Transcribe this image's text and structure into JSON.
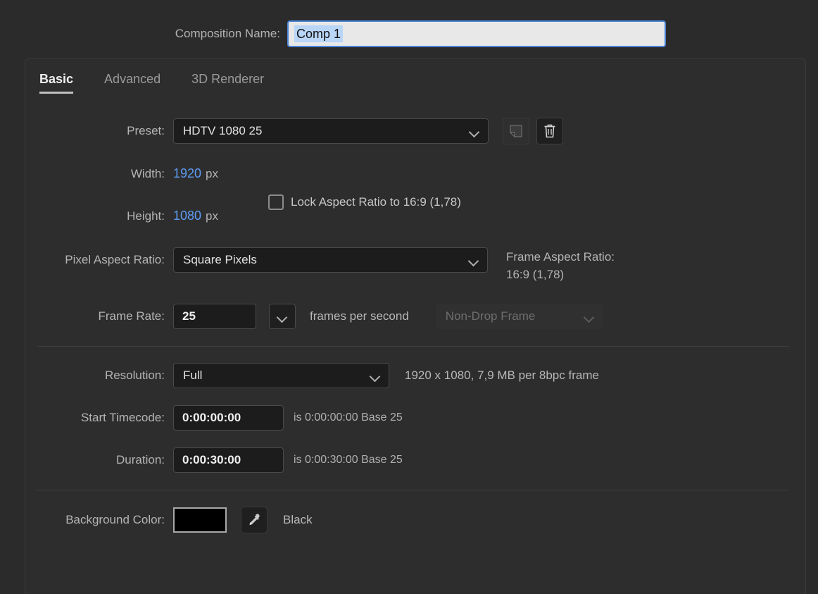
{
  "composition": {
    "name_label": "Composition Name:",
    "name_value": "Comp 1"
  },
  "tabs": [
    {
      "label": "Basic",
      "active": true
    },
    {
      "label": "Advanced",
      "active": false
    },
    {
      "label": "3D Renderer",
      "active": false
    }
  ],
  "preset": {
    "label": "Preset:",
    "value": "HDTV 1080 25",
    "save_icon": "save-preset-icon",
    "delete_icon": "trash-icon"
  },
  "dimensions": {
    "width_label": "Width:",
    "width_value": "1920",
    "width_unit": "px",
    "height_label": "Height:",
    "height_value": "1080",
    "height_unit": "px",
    "lock_aspect_label": "Lock Aspect Ratio to 16:9 (1,78)",
    "lock_aspect_checked": false
  },
  "pixel_aspect": {
    "label": "Pixel Aspect Ratio:",
    "value": "Square Pixels",
    "frame_ar_label": "Frame Aspect Ratio:",
    "frame_ar_value": "16:9 (1,78)"
  },
  "frame_rate": {
    "label": "Frame Rate:",
    "value": "25",
    "unit_label": "frames per second",
    "drop_frame_value": "Non-Drop Frame",
    "drop_frame_disabled": true
  },
  "resolution": {
    "label": "Resolution:",
    "value": "Full",
    "info": "1920 x 1080, 7,9 MB per 8bpc frame"
  },
  "start_timecode": {
    "label": "Start Timecode:",
    "value": "0:00:00:00",
    "info": "is 0:00:00:00  Base 25"
  },
  "duration": {
    "label": "Duration:",
    "value": "0:00:30:00",
    "info": "is 0:00:30:00  Base 25"
  },
  "background_color": {
    "label": "Background Color:",
    "swatch_hex": "#000000",
    "eyedropper_icon": "eyedropper-icon",
    "name": "Black"
  },
  "colors": {
    "accent_blue": "#5e9cf5",
    "panel_bg": "#2d2d2d",
    "window_bg": "#2b2b2b",
    "focus_border": "#4a84d8",
    "selection_highlight": "#b9d6f7"
  }
}
